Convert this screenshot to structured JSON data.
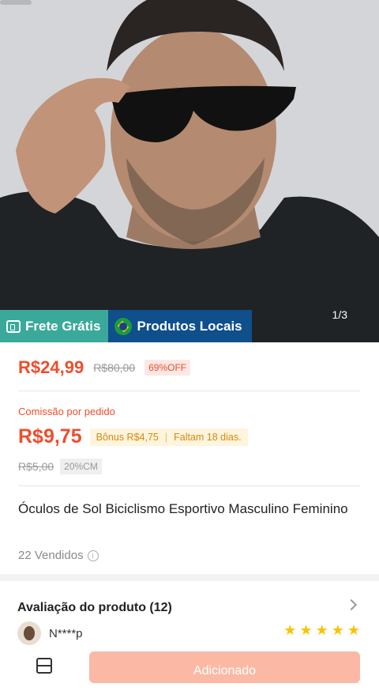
{
  "hero": {
    "image_description_icon": "product-photo",
    "pager": "1/3",
    "badges": {
      "frete": "Frete Grátis",
      "local": "Produtos Locais"
    }
  },
  "price": {
    "current": "R$24,99",
    "original": "R$80,00",
    "discount": "69%OFF"
  },
  "commission": {
    "label": "Comissão por pedido",
    "value": "R$9,75",
    "bonus": "Bônus R$4,75",
    "deadline": "Faltam 18 dias.",
    "old_value": "R$5,00",
    "rate": "20%CM"
  },
  "product": {
    "title": "Óculos de Sol Biciclismo Esportivo Masculino Feminino",
    "sold": "22 Vendidos"
  },
  "review": {
    "header": "Avaliação do produto (12)",
    "reviewer": "N****p",
    "stars": 5
  },
  "bottom": {
    "add_label": "Adicionado"
  },
  "colors": {
    "accent": "#ee4d2d",
    "frete_badge": "#3aa99a",
    "local_badge": "#0e4f8c",
    "star": "#f6c400"
  }
}
